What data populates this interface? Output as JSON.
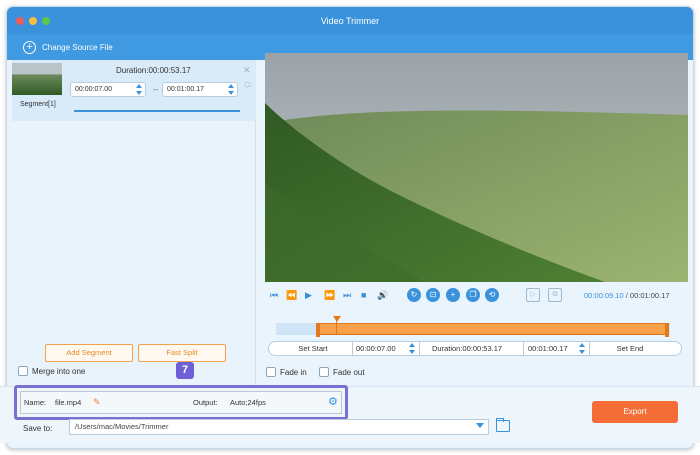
{
  "window": {
    "title": "Video Trimmer"
  },
  "toolbar": {
    "change_source_label": "Change Source File"
  },
  "segment": {
    "duration_label": "Duration:00:00:53.17",
    "start_time": "00:00:07.00",
    "end_time": "00:01:00.17",
    "separator": "--",
    "label": "Segment[1]"
  },
  "left_actions": {
    "add_segment": "Add Segment",
    "fast_split": "Fast Split",
    "merge_label": "Merge into one"
  },
  "callout": {
    "number": "7"
  },
  "playback": {
    "current_time": "00:00:09.10",
    "separator": "/",
    "total_time": "00:01:00.17"
  },
  "trim_bar": {
    "set_start": "Set Start",
    "start_value": "00:00:07.00",
    "duration": "Duration:00:00:53.17",
    "end_value": "00:01:00.17",
    "set_end": "Set End"
  },
  "fade": {
    "fade_in": "Fade in",
    "fade_out": "Fade out"
  },
  "output": {
    "name_label": "Name:",
    "name_value": "file.mp4",
    "output_label": "Output:",
    "output_value": "Auto;24fps"
  },
  "save": {
    "label": "Save to:",
    "path": "/Users/mac/Movies/Trimmer"
  },
  "export_label": "Export",
  "colors": {
    "accent": "#3a92dc",
    "export": "#f46d37",
    "segment_orange": "#f9a04a",
    "highlight": "#7c6fd3"
  }
}
